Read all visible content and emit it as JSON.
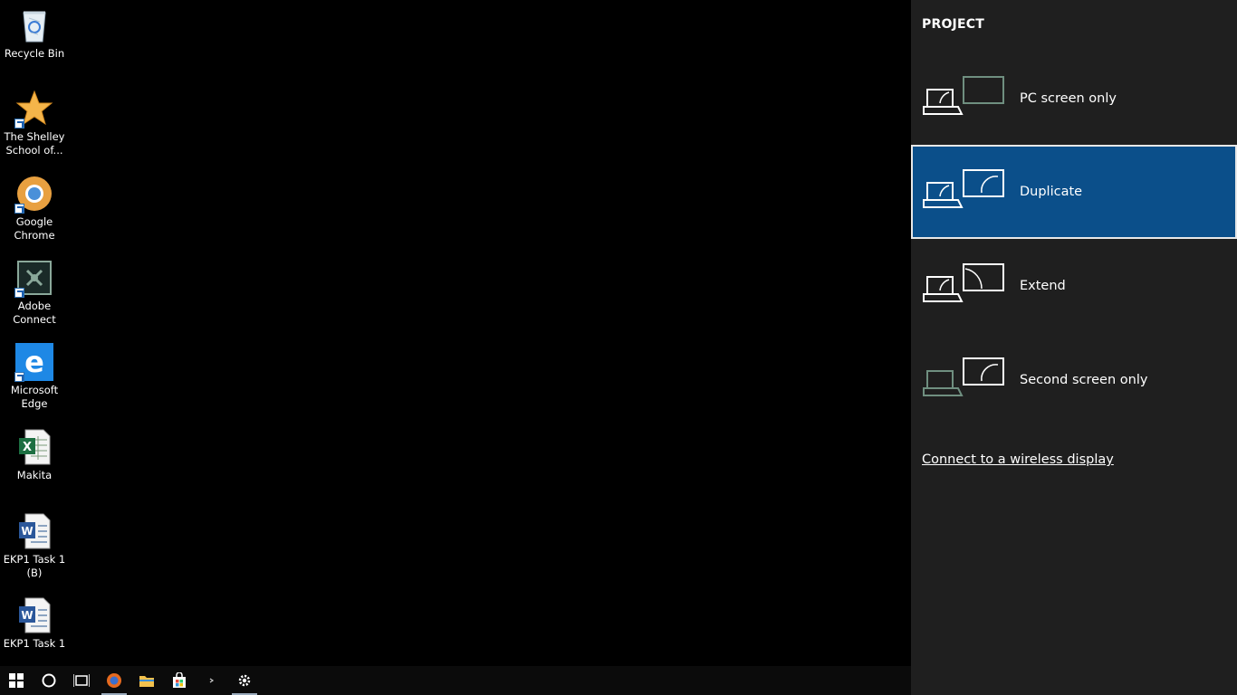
{
  "desktop": {
    "icons": [
      {
        "label": "Recycle Bin",
        "icon": "recycle-bin-icon"
      },
      {
        "label": "The Shelley\nSchool of...",
        "icon": "star-icon"
      },
      {
        "label": "Google\nChrome",
        "icon": "chrome-icon"
      },
      {
        "label": "Adobe\nConnect",
        "icon": "adobe-connect-icon"
      },
      {
        "label": "Microsoft\nEdge",
        "icon": "edge-icon"
      },
      {
        "label": "Makita",
        "icon": "excel-file-icon"
      },
      {
        "label": "EKP1 Task 1\n(B)",
        "icon": "word-file-icon"
      },
      {
        "label": "EKP1 Task 1",
        "icon": "word-file-icon"
      }
    ]
  },
  "taskbar": {
    "items": [
      "start-icon",
      "cortana-icon",
      "task-view-icon",
      "firefox-icon",
      "file-explorer-icon",
      "store-icon",
      "more-icon",
      "settings-icon"
    ]
  },
  "project": {
    "title": "PROJECT",
    "options": [
      {
        "label": "PC screen only",
        "selected": false
      },
      {
        "label": "Duplicate",
        "selected": true
      },
      {
        "label": "Extend",
        "selected": false
      },
      {
        "label": "Second screen only",
        "selected": false
      }
    ],
    "wireless_link": "Connect to a wireless display"
  },
  "colors": {
    "panel_bg": "#1f1f1f",
    "selected_bg": "#0b4f8a",
    "inactive_outline": "#6f8f80"
  }
}
